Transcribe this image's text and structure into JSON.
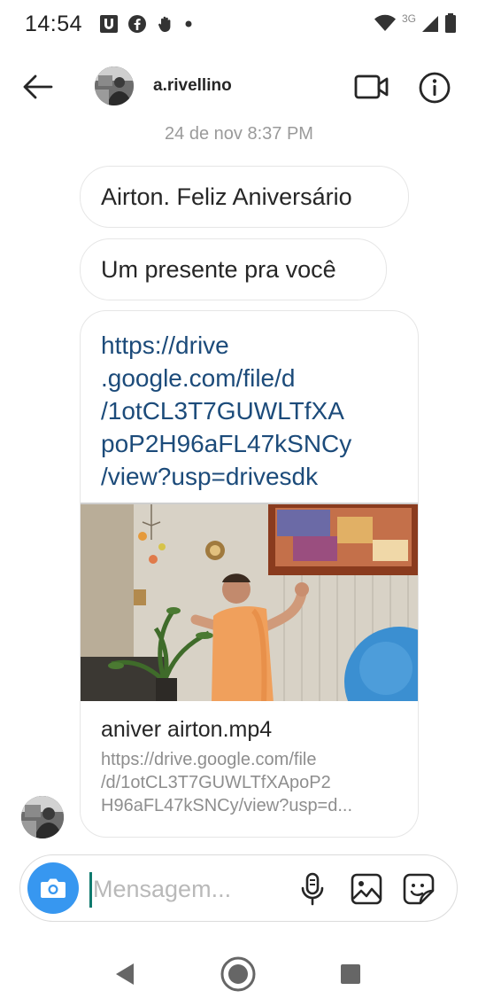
{
  "status_bar": {
    "time": "14:54",
    "network_label": "3G",
    "left_icons": [
      "u-app-icon",
      "facebook-icon",
      "hand-icon",
      "dot-icon"
    ],
    "right_icons": [
      "wifi-icon",
      "signal-icon",
      "battery-icon"
    ]
  },
  "header": {
    "username": "a.rivellino",
    "icons": [
      "back-arrow-icon",
      "video-call-icon",
      "info-icon"
    ]
  },
  "conversation": {
    "timestamp": "24 de nov 8:37 PM",
    "messages": [
      {
        "text": "Airton. Feliz Aniversário"
      },
      {
        "text": "Um presente pra você"
      }
    ],
    "link_message": {
      "url_lines": [
        "https://drive",
        ".google.com/file/d",
        "/1otCL3T7GUWLTfXA",
        "poP2H96aFL47kSNCy",
        "/view?usp=drivesdk"
      ],
      "preview_title": "aniver airton.mp4",
      "preview_url_lines": [
        "https://drive.google.com/file",
        "/d/1otCL3T7GUWLTfXApoP2",
        "H96aFL47kSNCy/view?usp=d..."
      ]
    }
  },
  "composer": {
    "placeholder": "Mensagem...",
    "accent_color": "#3797f0",
    "icons": [
      "camera-icon",
      "microphone-icon",
      "gallery-icon",
      "sticker-icon"
    ]
  },
  "nav_bar": {
    "icons": [
      "nav-back-icon",
      "nav-home-icon",
      "nav-recents-icon"
    ]
  },
  "colors": {
    "link_text": "#1c4b7a",
    "timestamp": "#9a9a9a",
    "bubble_border": "#e6e6e6"
  }
}
